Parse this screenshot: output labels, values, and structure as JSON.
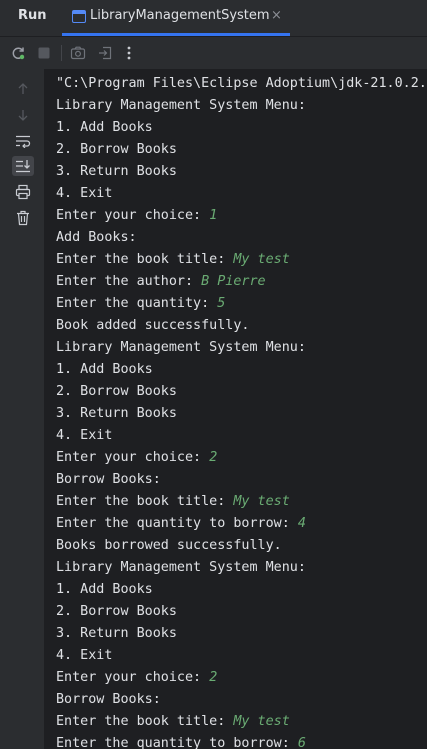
{
  "header": {
    "run_label": "Run",
    "tab_title": "LibraryManagementSystem",
    "close_glyph": "×"
  },
  "toolbar": {
    "icons": [
      "rerun-icon",
      "stop-icon",
      "camera-icon",
      "exit-icon",
      "more-icon"
    ]
  },
  "gutter": {
    "icons": [
      "up-arrow-icon",
      "down-arrow-icon",
      "soft-wrap-icon",
      "scroll-to-end-icon",
      "print-icon",
      "trash-icon"
    ]
  },
  "colors": {
    "background": "#1e1f22",
    "panel": "#2b2d30",
    "text": "#dfe1e5",
    "user_input": "#6aab73",
    "accent": "#3574f0"
  },
  "console": {
    "lines": [
      {
        "text": "\"C:\\Program Files\\Eclipse Adoptium\\jdk-21.0.2.1",
        "input": ""
      },
      {
        "text": "Library Management System Menu:",
        "input": ""
      },
      {
        "text": "1. Add Books",
        "input": ""
      },
      {
        "text": "2. Borrow Books",
        "input": ""
      },
      {
        "text": "3. Return Books",
        "input": ""
      },
      {
        "text": "4. Exit",
        "input": ""
      },
      {
        "text": "Enter your choice: ",
        "input": "1"
      },
      {
        "text": "Add Books:",
        "input": ""
      },
      {
        "text": "Enter the book title: ",
        "input": "My test"
      },
      {
        "text": "Enter the author: ",
        "input": "B Pierre"
      },
      {
        "text": "Enter the quantity: ",
        "input": "5"
      },
      {
        "text": "Book added successfully.",
        "input": ""
      },
      {
        "text": "Library Management System Menu:",
        "input": ""
      },
      {
        "text": "1. Add Books",
        "input": ""
      },
      {
        "text": "2. Borrow Books",
        "input": ""
      },
      {
        "text": "3. Return Books",
        "input": ""
      },
      {
        "text": "4. Exit",
        "input": ""
      },
      {
        "text": "Enter your choice: ",
        "input": "2"
      },
      {
        "text": "Borrow Books:",
        "input": ""
      },
      {
        "text": "Enter the book title: ",
        "input": "My test"
      },
      {
        "text": "Enter the quantity to borrow: ",
        "input": "4"
      },
      {
        "text": "Books borrowed successfully.",
        "input": ""
      },
      {
        "text": "Library Management System Menu:",
        "input": ""
      },
      {
        "text": "1. Add Books",
        "input": ""
      },
      {
        "text": "2. Borrow Books",
        "input": ""
      },
      {
        "text": "3. Return Books",
        "input": ""
      },
      {
        "text": "4. Exit",
        "input": ""
      },
      {
        "text": "Enter your choice: ",
        "input": "2"
      },
      {
        "text": "Borrow Books:",
        "input": ""
      },
      {
        "text": "Enter the book title: ",
        "input": "My test"
      },
      {
        "text": "Enter the quantity to borrow: ",
        "input": "6"
      }
    ]
  }
}
